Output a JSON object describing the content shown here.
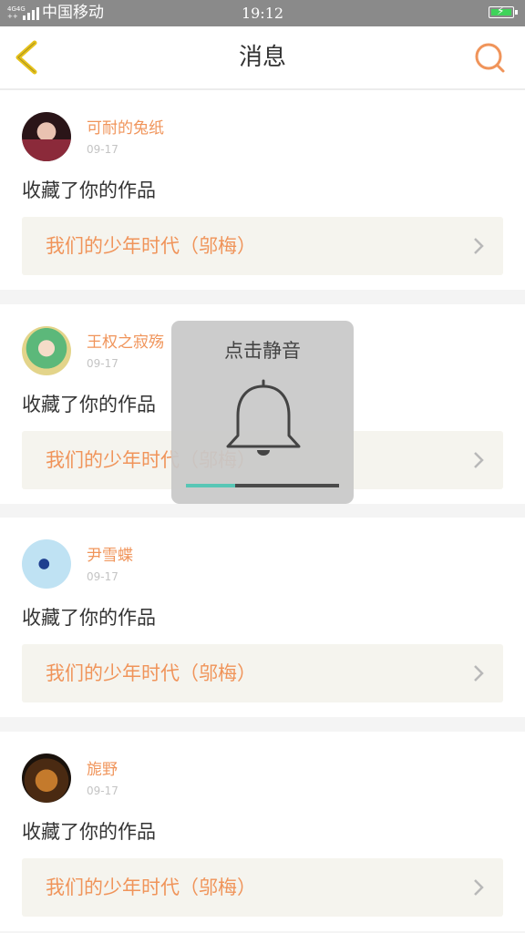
{
  "status_bar": {
    "network_top": "4G4G",
    "network_bottom": "++",
    "carrier": "中国移动",
    "time": "19:12",
    "battery_color": "#3fd35a"
  },
  "nav": {
    "title": "消息",
    "back_icon": "chevron-left-icon",
    "search_icon": "search-icon",
    "accent_back": "#e6c21a",
    "accent_search": "#f0945a"
  },
  "messages": [
    {
      "user": "可耐的兔纸",
      "date": "09-17",
      "action": "收藏了你的作品",
      "work": "我们的少年时代（邬梅）"
    },
    {
      "user": "王权之寂殇",
      "date": "09-17",
      "action": "收藏了你的作品",
      "work": "我们的少年时代（邬梅）"
    },
    {
      "user": "尹雪蝶",
      "date": "09-17",
      "action": "收藏了你的作品",
      "work": "我们的少年时代（邬梅）"
    },
    {
      "user": "旎野",
      "date": "09-17",
      "action": "收藏了你的作品",
      "work": "我们的少年时代（邬梅）"
    }
  ],
  "mute_overlay": {
    "label": "点击静音",
    "icon": "bell-icon",
    "progress": 0.32,
    "progress_color": "#58c6b5"
  }
}
